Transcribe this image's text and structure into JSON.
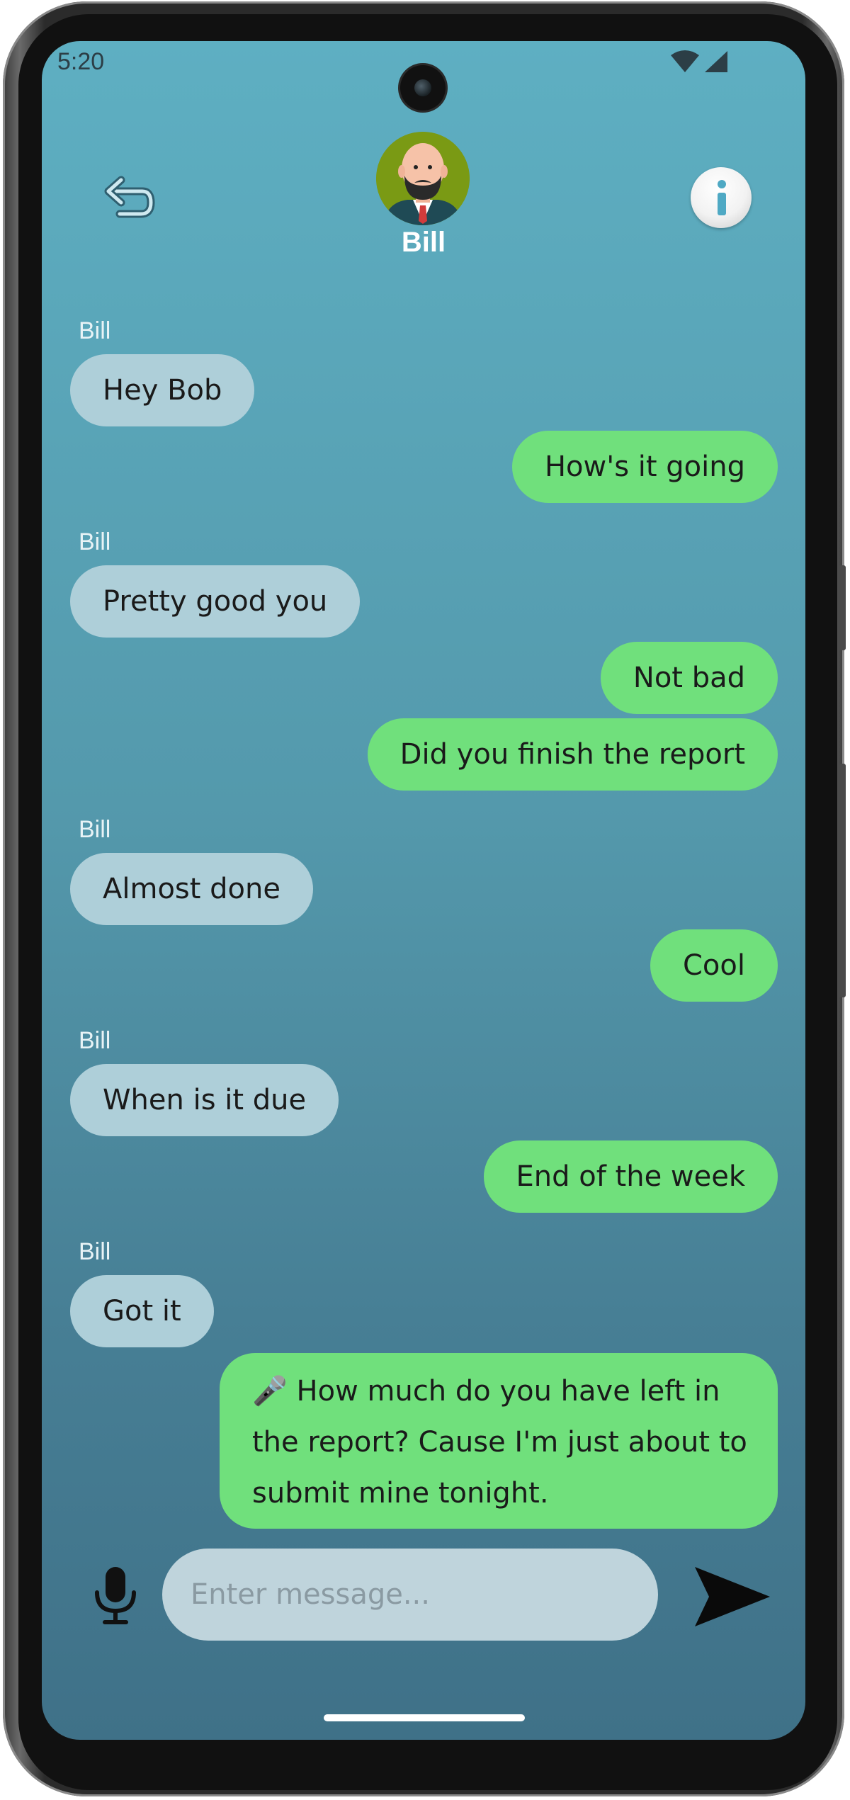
{
  "status_bar": {
    "time": "5:20"
  },
  "header": {
    "contact_name": "Bill"
  },
  "messages": [
    {
      "from": "Bill",
      "sender_label": "Bill",
      "text": "Hey Bob"
    },
    {
      "from": "me",
      "text": "How's it going"
    },
    {
      "from": "Bill",
      "sender_label": "Bill",
      "text": "Pretty good you"
    },
    {
      "from": "me",
      "text": "Not bad"
    },
    {
      "from": "me",
      "text": "Did you finish the report"
    },
    {
      "from": "Bill",
      "sender_label": "Bill",
      "text": "Almost done"
    },
    {
      "from": "me",
      "text": "Cool"
    },
    {
      "from": "Bill",
      "sender_label": "Bill",
      "text": "When is it due"
    },
    {
      "from": "me",
      "text": "End of the week"
    },
    {
      "from": "Bill",
      "sender_label": "Bill",
      "text": "Got it"
    },
    {
      "from": "me",
      "text": "🎤 How much do you have left in the report? Cause I'm just about to submit mine tonight."
    }
  ],
  "composer": {
    "placeholder": "Enter message...",
    "value": ""
  },
  "colors": {
    "incoming_bubble": "#aecfd9",
    "outgoing_bubble": "#70e07c",
    "background_top": "#5eafc2",
    "background_bottom": "#3f7188",
    "input_background": "#bfd4dc"
  },
  "icons": {
    "back": "undo-arrow-icon",
    "info": "info-icon",
    "mic": "microphone-icon",
    "send": "send-arrow-icon",
    "wifi": "wifi-icon",
    "signal": "cell-signal-icon"
  }
}
